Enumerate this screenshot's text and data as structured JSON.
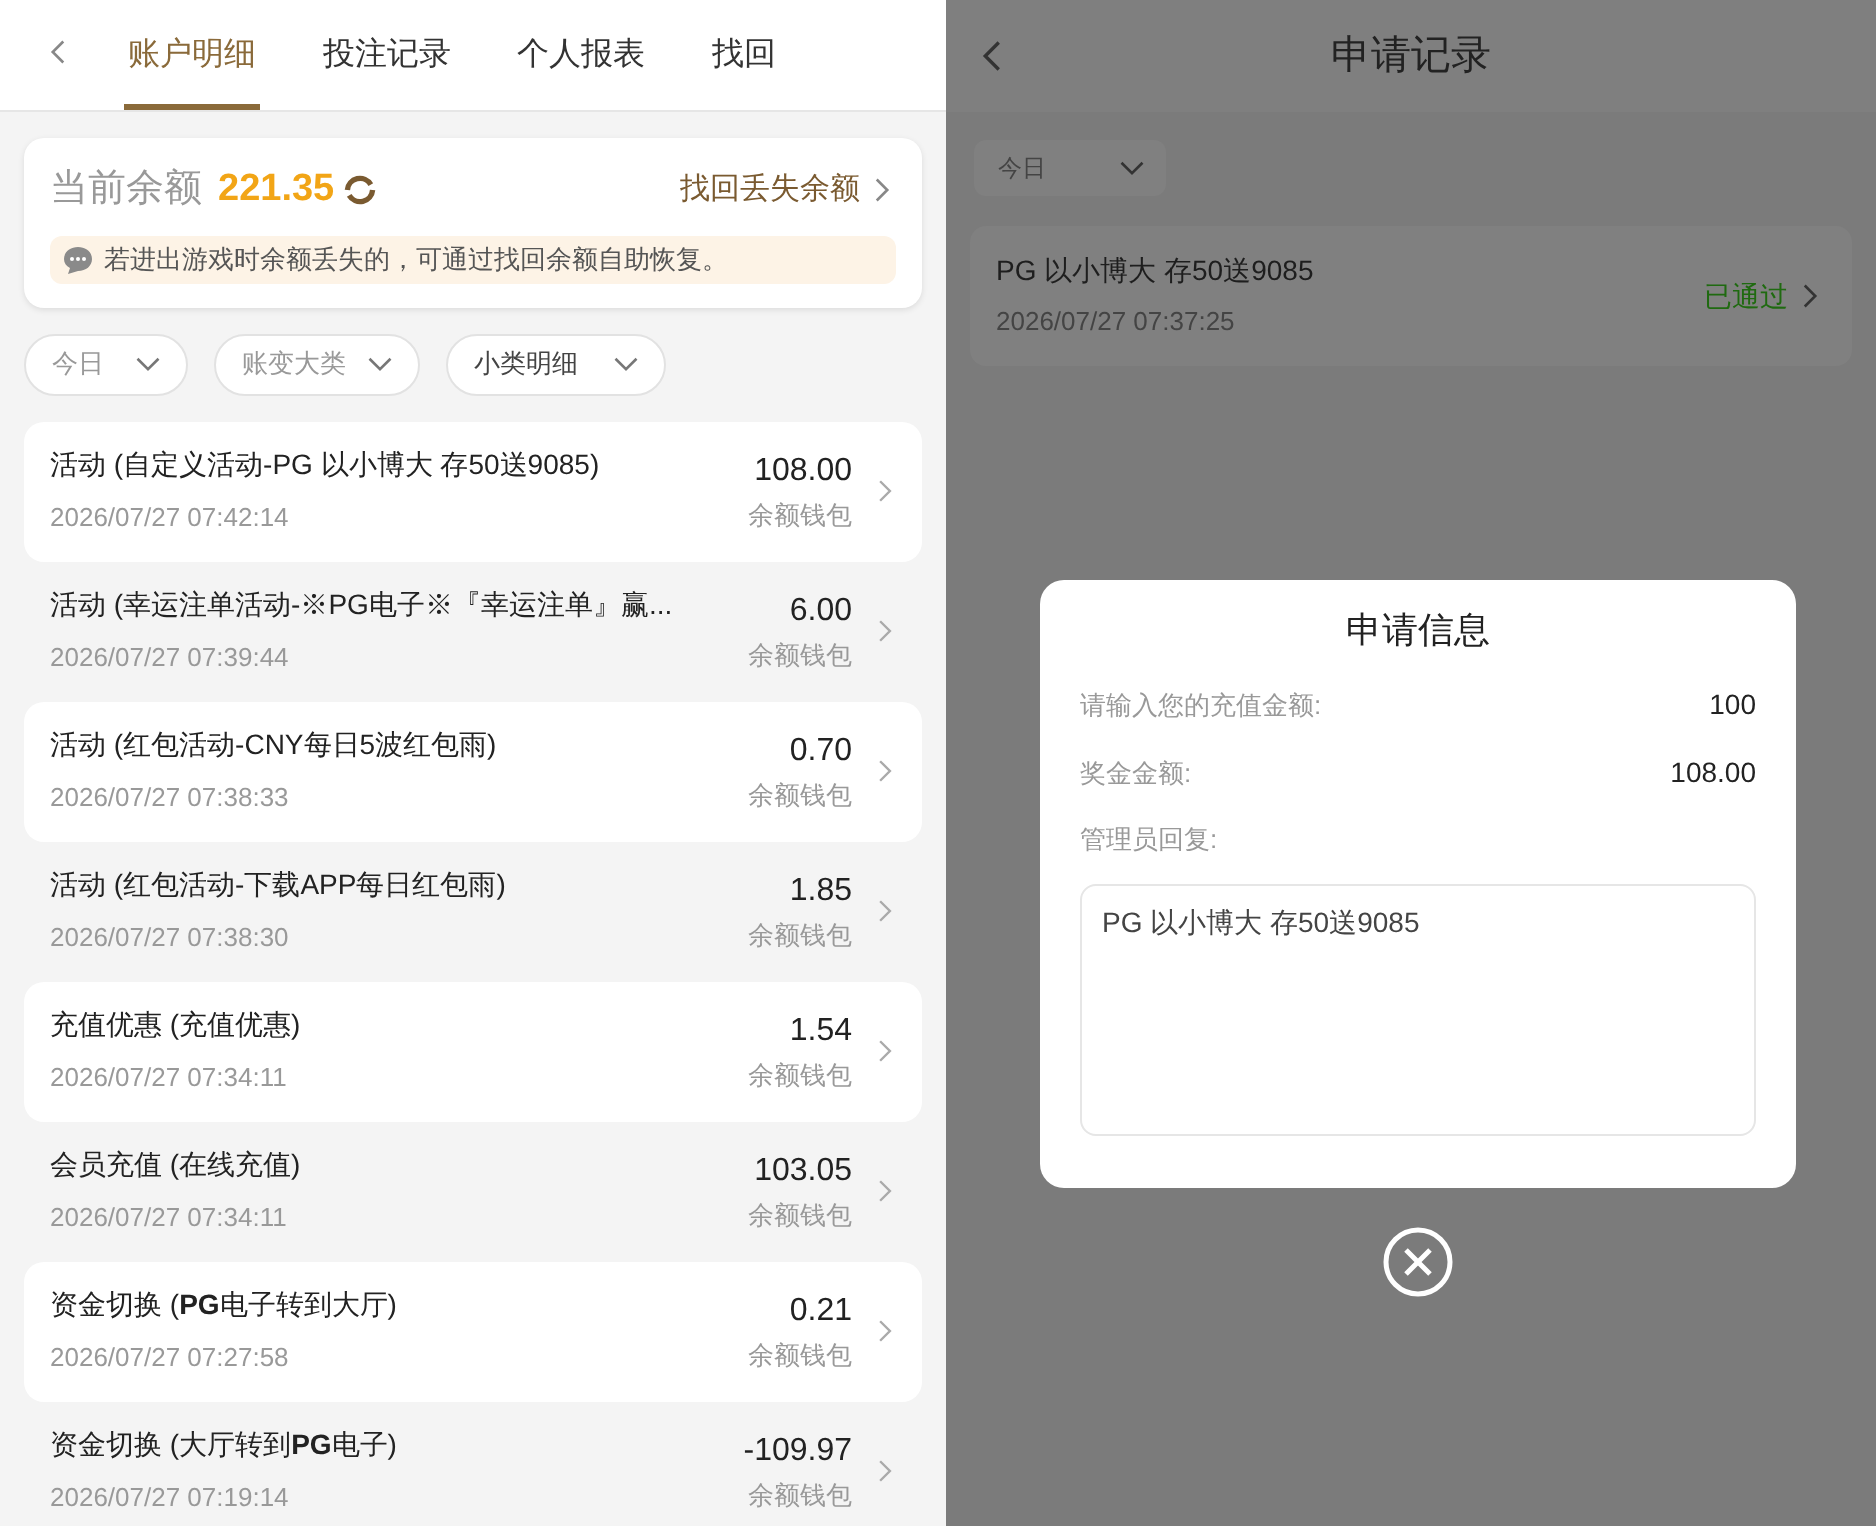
{
  "left": {
    "tabs": [
      {
        "label": "账户明细",
        "selected": true
      },
      {
        "label": "投注记录",
        "selected": false
      },
      {
        "label": "个人报表",
        "selected": false
      },
      {
        "label": "找回",
        "selected": false
      }
    ],
    "balance": {
      "label": "当前余额",
      "amount": "221.35",
      "recover_link": "找回丢失余额",
      "notice": "若进出游戏时余额丢失的，可通过找回余额自助恢复。"
    },
    "filters": [
      "今日",
      "账变大类",
      "小类明细"
    ],
    "rows": [
      {
        "title": "活动 (自定义活动-PG 以小博大 存50送9085)",
        "time": "2026/07/27 07:42:14",
        "amount": "108.00",
        "wallet": "余额钱包"
      },
      {
        "title": "活动 (幸运注单活动-※PG电子※『幸运注单』赢...",
        "time": "2026/07/27 07:39:44",
        "amount": "6.00",
        "wallet": "余额钱包"
      },
      {
        "title": "活动 (红包活动-CNY每日5波红包雨)",
        "time": "2026/07/27 07:38:33",
        "amount": "0.70",
        "wallet": "余额钱包"
      },
      {
        "title": "活动 (红包活动-下载APP每日红包雨)",
        "time": "2026/07/27 07:38:30",
        "amount": "1.85",
        "wallet": "余额钱包"
      },
      {
        "title": "充值优惠 (充值优惠)",
        "time": "2026/07/27 07:34:11",
        "amount": "1.54",
        "wallet": "余额钱包"
      },
      {
        "title": "会员充值 (在线充值)",
        "time": "2026/07/27 07:34:11",
        "amount": "103.05",
        "wallet": "余额钱包"
      },
      {
        "title": "资金切换 (**PG**电子转到大厅)",
        "time": "2026/07/27 07:27:58",
        "amount": "0.21",
        "wallet": "余额钱包"
      },
      {
        "title": "资金切换 (大厅转到**PG**电子)",
        "time": "2026/07/27 07:19:14",
        "amount": "-109.97",
        "wallet": "余额钱包"
      }
    ]
  },
  "right": {
    "title": "申请记录",
    "filter": "今日",
    "record": {
      "title": "PG 以小博大 存50送9085",
      "time": "2026/07/27 07:37:25",
      "status": "已通过"
    },
    "dialog": {
      "title": "申请信息",
      "fields": [
        {
          "label": "请输入您的充值金额:",
          "value": "100"
        },
        {
          "label": "奖金金额:",
          "value": "108.00"
        }
      ],
      "reply_label": "管理员回复:",
      "reply": "PG 以小博大 存50送9085"
    }
  }
}
